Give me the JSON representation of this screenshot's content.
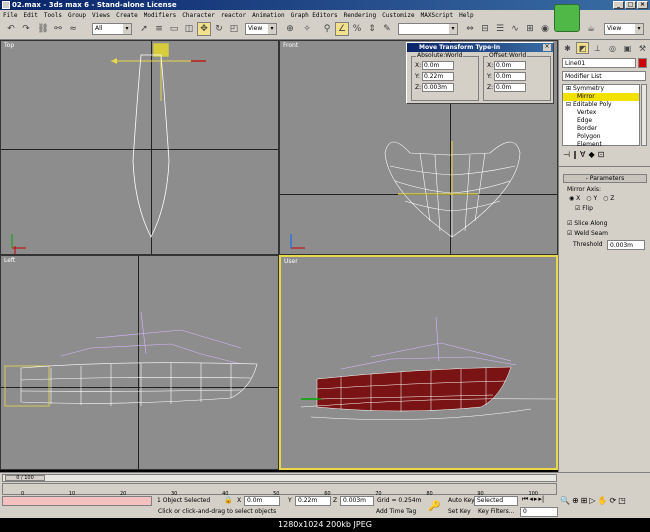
{
  "window": {
    "title": "02.max - 3ds max 6 - Stand-alone License"
  },
  "menu": [
    "File",
    "Edit",
    "Tools",
    "Group",
    "Views",
    "Create",
    "Modifiers",
    "Character",
    "reactor",
    "Animation",
    "Graph Editors",
    "Rendering",
    "Customize",
    "MAXScript",
    "Help"
  ],
  "toolbar": {
    "selection_filter": "All",
    "ref_coord": "View",
    "ref_coord_right": "View"
  },
  "viewports": {
    "top": "Top",
    "front": "Front",
    "left": "Left",
    "user": "User"
  },
  "dialog": {
    "title": "Move Transform Type-In",
    "absolute_label": "Absolute:World",
    "offset_label": "Offset:World",
    "axes": [
      "X:",
      "Y:",
      "Z:"
    ],
    "absolute": [
      "0.0m",
      "0.22m",
      "0.003m"
    ],
    "offset": [
      "0.0m",
      "0.0m",
      "0.0m"
    ]
  },
  "command_panel": {
    "object_name": "Line01",
    "modifier_list": "Modifier List",
    "stack": [
      "Symmetry",
      "Mirror",
      "Editable Poly",
      "Vertex",
      "Edge",
      "Border",
      "Polygon",
      "Element"
    ],
    "parameters_header": "Parameters",
    "mirror_axis_label": "Mirror Axis:",
    "axes": [
      "X",
      "Y",
      "Z"
    ],
    "flip_label": "Flip",
    "slice_along_label": "Slice Along",
    "weld_seam_label": "Weld Seam",
    "threshold_label": "Threshold",
    "threshold_value": "0.003m"
  },
  "timeline": {
    "frame_label": "0 / 100",
    "ticks": [
      "0",
      "10",
      "20",
      "30",
      "40",
      "50",
      "60",
      "70",
      "80",
      "90",
      "100"
    ]
  },
  "status": {
    "selection": "1 Object Selected",
    "prompt": "Click or click-and-drag to select objects",
    "x": "0.0m",
    "y": "0.22m",
    "z": "0.003m",
    "grid": "Grid = 0.254m",
    "add_time_tag": "Add Time Tag",
    "auto_key": "Auto Key",
    "set_key": "Set Key",
    "selected": "Selected",
    "key_filters": "Key Filters...",
    "frame_value": "0"
  },
  "image_caption": "1280x1024  200kb  JPEG"
}
